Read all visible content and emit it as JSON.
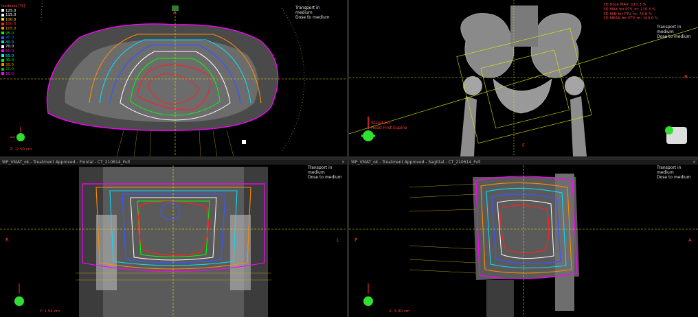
{
  "legend": {
    "header": "Isodoses [%]",
    "levels": [
      {
        "label": "125.0",
        "color": "#ffffff"
      },
      {
        "label": "115.0",
        "color": "#ffffff"
      },
      {
        "label": "110.0",
        "color": "#ffe000"
      },
      {
        "label": "100.0",
        "color": "#ff2020"
      },
      {
        "label": "105.0",
        "color": "#ff8c00"
      },
      {
        "label": "95.0",
        "color": "#00ff00"
      },
      {
        "label": "90.0",
        "color": "#3a56ff"
      },
      {
        "label": "80.0",
        "color": "#00e0ff"
      },
      {
        "label": "70.0",
        "color": "#ffffff"
      },
      {
        "label": "60.0",
        "color": "#ff00ff"
      },
      {
        "label": "50.0",
        "color": "#00ffff"
      },
      {
        "label": "40.0",
        "color": "#00ff00"
      },
      {
        "label": "30.0",
        "color": "#ff7f00"
      },
      {
        "label": "20.0",
        "color": "#00c000"
      },
      {
        "label": "10.0",
        "color": "#ff00ff"
      }
    ]
  },
  "panes": {
    "tl": {
      "transport": "Transport in\nmedium\nDose to medium",
      "zoom": "Z: -2.50 cm",
      "dir_top": "A"
    },
    "tr": {
      "transport": "Transport in\nmedium\nDose to medium",
      "stats": [
        "3D Dose MAX: 110.3 %",
        "3D MAX for PTV_m: 110.3 %",
        "3D MIN for PTV_m: 74.8 %",
        "3D MEAN for PTV_m: 100.0 %"
      ],
      "orient": "Standard\nHead First Supine",
      "dir_right": "R",
      "dir_bottom": "F"
    },
    "bl": {
      "title": "WP_VMAT_ok - Treatment Approved - Frontal - CT_210614_Full",
      "transport": "Transport in\nmedium\nDose to medium",
      "zoom": "Y: 1.54 cm",
      "dir_left": "R",
      "dir_right": "L"
    },
    "br": {
      "title": "WP_VMAT_ok - Treatment Approved - Sagittal - CT_210614_Full",
      "transport": "Transport in\nmedium\nDose to medium",
      "zoom": "X: 3.00 cm",
      "dir_left": "P",
      "dir_right": "A"
    }
  },
  "colors": {
    "isodose_red": "#ff2020",
    "grid_yellow": "#e6e600",
    "crosshair_red": "#ff3030"
  }
}
